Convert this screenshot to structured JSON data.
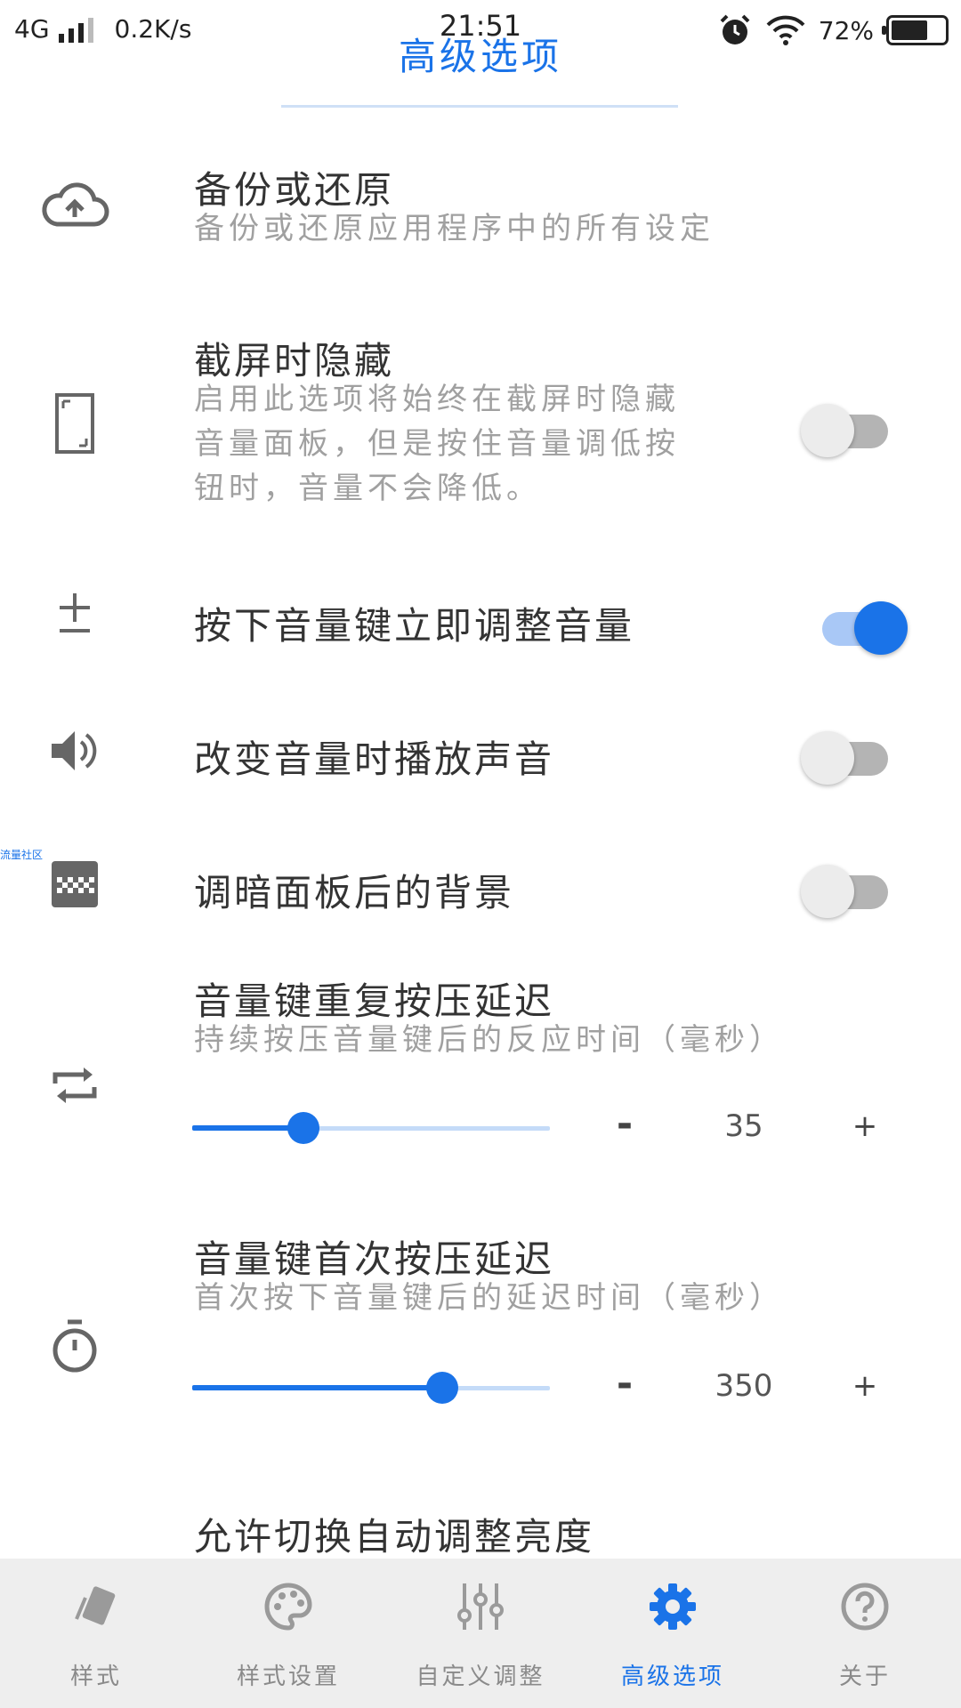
{
  "status_bar": {
    "network": "4G",
    "speed": "0.2K/s",
    "time": "21:51",
    "battery": "72%",
    "battery_level": 0.72
  },
  "header": {
    "title": "高级选项"
  },
  "rows": {
    "backup": {
      "icon": "cloud-upload-icon",
      "title": "备份或还原",
      "subtitle": "备份或还原应用程序中的所有设定"
    },
    "screenshot_hide": {
      "icon": "phone-outline-icon",
      "title": "截屏时隐藏",
      "subtitle_lines": [
        "启用此选项将始终在截屏时隐藏",
        "音量面板，但是按住音量调低按",
        "钮时，音量不会降低。"
      ],
      "enabled": false
    },
    "instant_adjust": {
      "icon": "plus-minus-icon",
      "title": "按下音量键立即调整音量",
      "enabled": true
    },
    "play_sound": {
      "icon": "speaker-icon",
      "title": "改变音量时播放声音",
      "enabled": false
    },
    "dim_background": {
      "icon": "checker-icon",
      "title": "调暗面板后的背景",
      "enabled": false
    },
    "repeat_delay": {
      "icon": "repeat-icon",
      "title": "音量键重复按压延迟",
      "subtitle": "持续按压音量键后的反应时间（毫秒）",
      "value": "35",
      "slider_fraction": 0.31,
      "minus": "-",
      "plus": "+"
    },
    "first_delay": {
      "icon": "timer-icon",
      "title": "音量键首次按压延迟",
      "subtitle": "首次按下音量键后的延迟时间（毫秒）",
      "value": "350",
      "slider_fraction": 0.7,
      "minus": "-",
      "plus": "+"
    },
    "auto_brightness": {
      "title": "允许切换自动调整亮度"
    }
  },
  "watermark": "流量社区",
  "bottom_nav": [
    {
      "label": "样式",
      "icon": "card-icon",
      "active": false
    },
    {
      "label": "样式设置",
      "icon": "palette-icon",
      "active": false
    },
    {
      "label": "自定义调整",
      "icon": "sliders-icon",
      "active": false
    },
    {
      "label": "高级选项",
      "icon": "gear-icon",
      "active": true
    },
    {
      "label": "关于",
      "icon": "help-icon",
      "active": false
    }
  ],
  "colors": {
    "accent": "#1a73e8",
    "nav_bg": "#eeeeee",
    "toggle_off": "#b4b4b4"
  }
}
